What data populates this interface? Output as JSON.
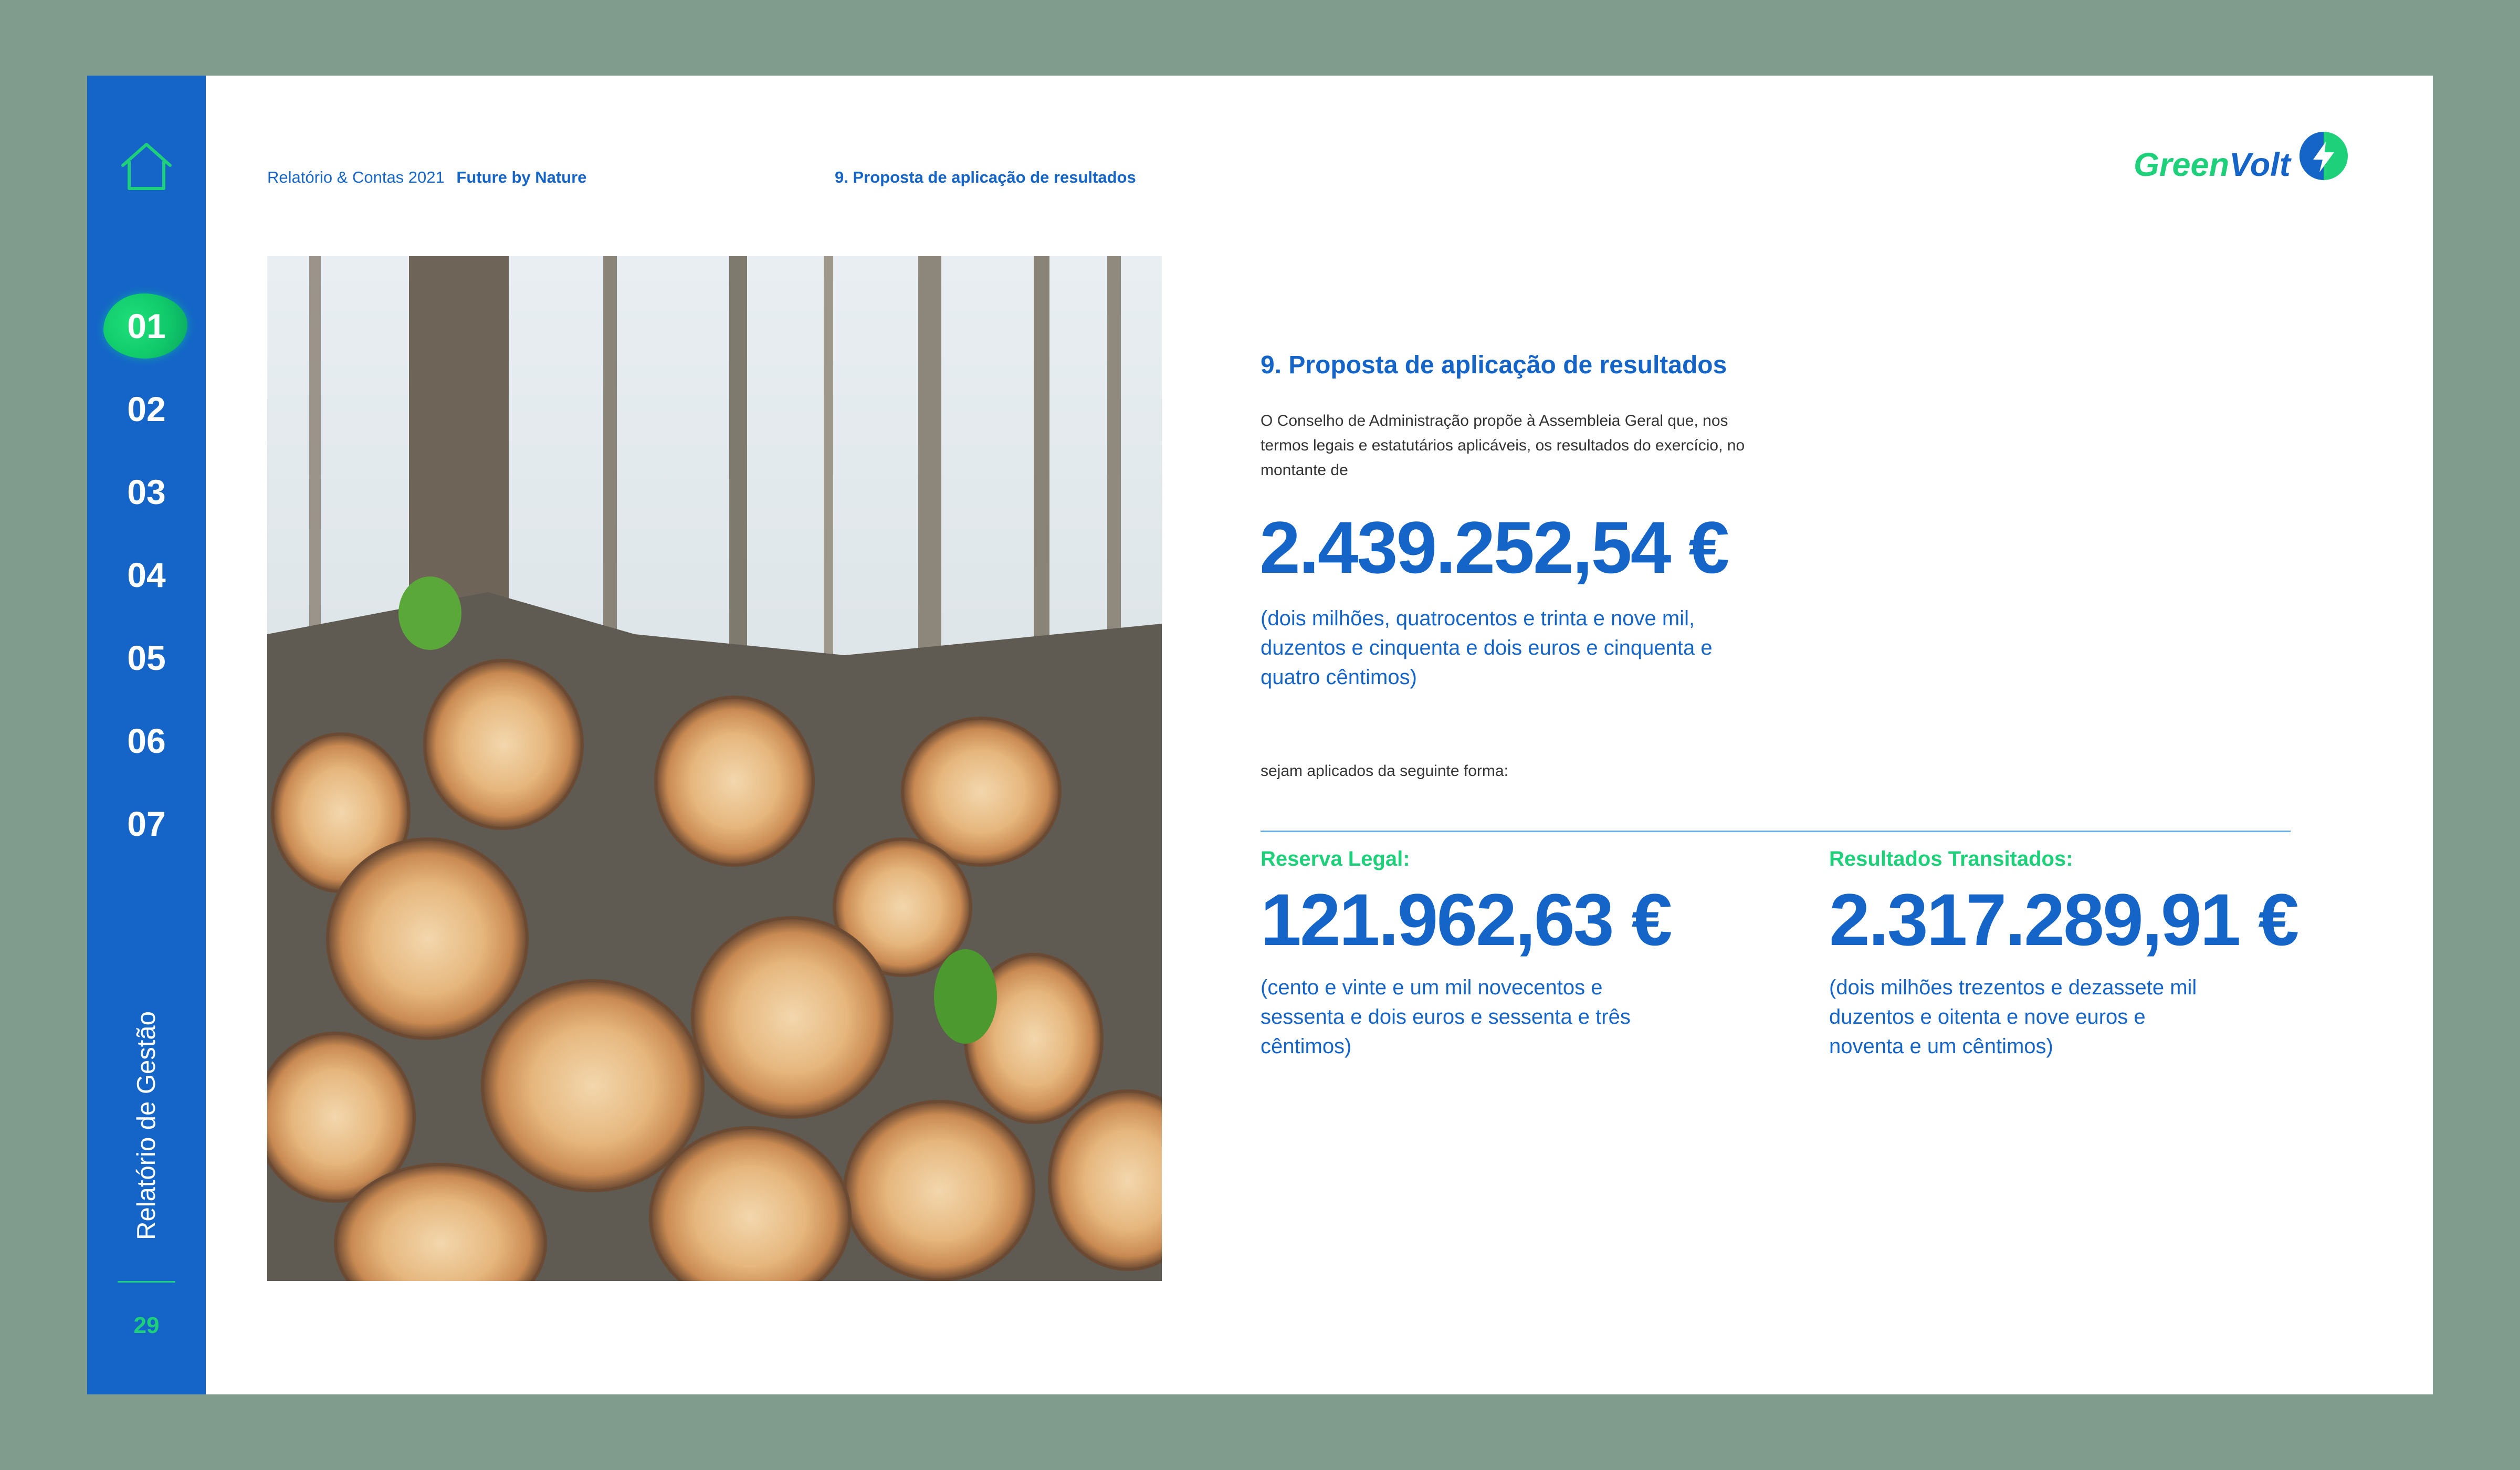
{
  "sidebar": {
    "chapters": [
      "01",
      "02",
      "03",
      "04",
      "05",
      "06",
      "07"
    ],
    "active_chapter": "01",
    "vertical_label": "Relatório de Gestão",
    "page_number": "29",
    "home_icon": "home-icon"
  },
  "header": {
    "report": "Relatório & Contas 2021",
    "tagline": "Future by Nature",
    "section": "9. Proposta de aplicação de resultados",
    "logo_text_green": "Green",
    "logo_text_blue": "Volt"
  },
  "content": {
    "title": "9. Proposta de aplicação de resultados",
    "intro": "O Conselho de Administração propõe à Assembleia Geral que, nos termos legais e estatutários aplicáveis, os resultados do exercício, no montante de",
    "total_value": "2.439.252,54 €",
    "total_words": "(dois milhões, quatrocentos e trinta e nove mil, duzentos e cinquenta e dois euros e cinquenta e quatro cêntimos)",
    "apply_text": "sejam aplicados da seguinte forma:",
    "allocations": [
      {
        "label": "Reserva Legal:",
        "value": "121.962,63 €",
        "words": "(cento e vinte e um mil novecentos e sessenta e dois euros e sessenta e três cêntimos)"
      },
      {
        "label": "Resultados Transitados:",
        "value": "2.317.289,91 €",
        "words": "(dois milhões trezentos e dezassete mil duzentos e oitenta e nove euros e noventa e um cêntimos)"
      }
    ]
  },
  "colors": {
    "brand_blue": "#1565c8",
    "brand_green": "#1ed07a",
    "frame": "#7f9c8c"
  }
}
